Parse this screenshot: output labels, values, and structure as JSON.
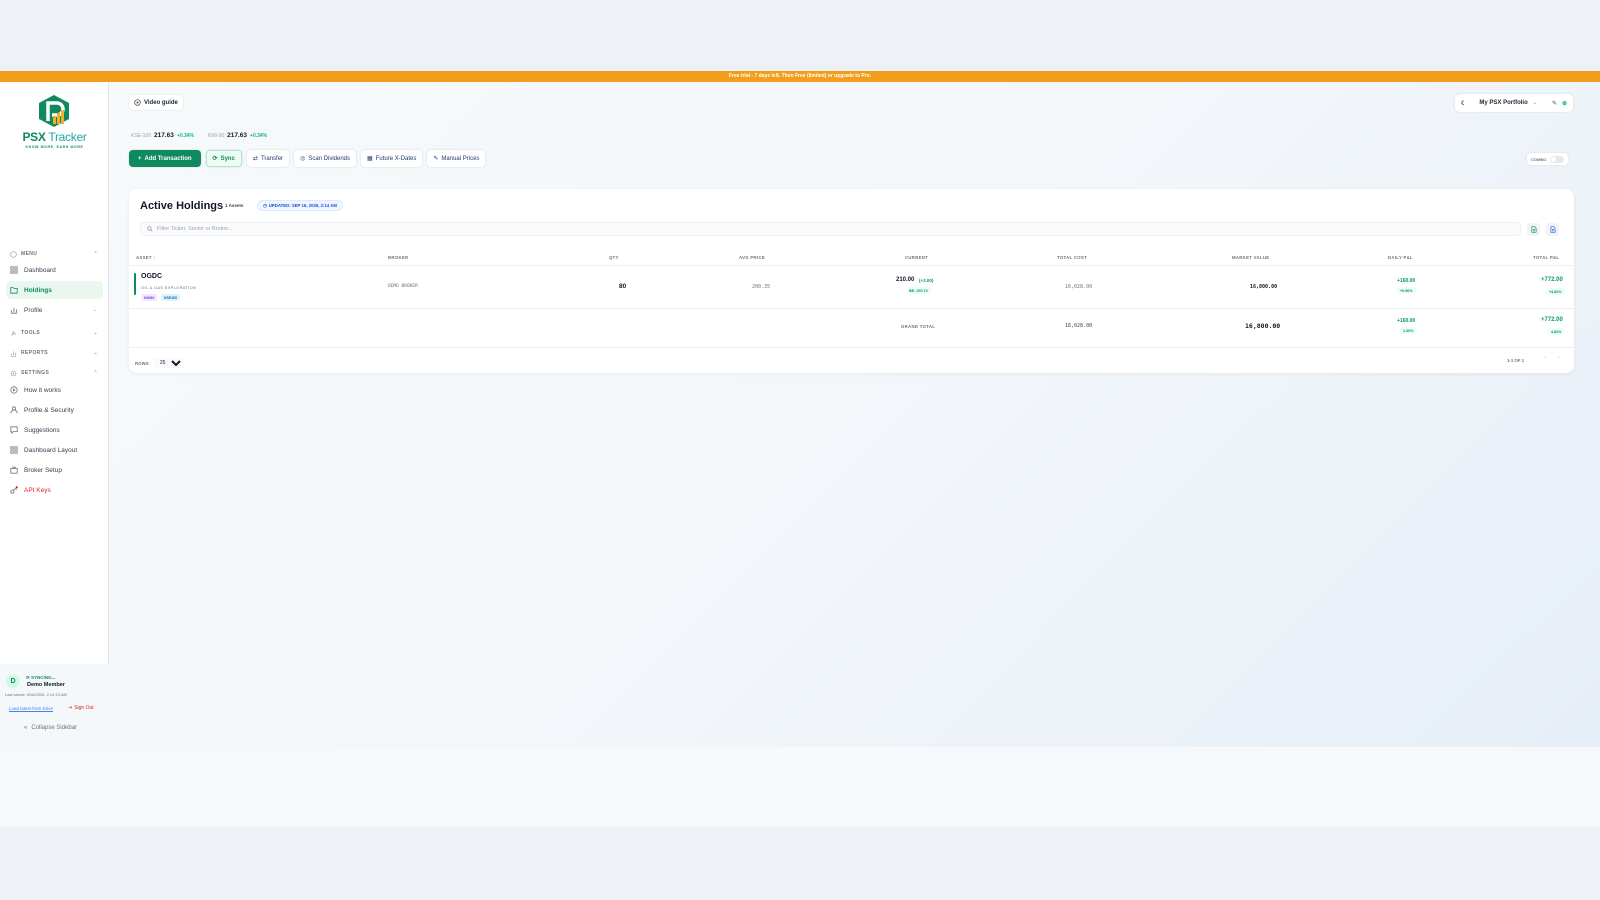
{
  "banner": {
    "text": "Free trial - 7 days left. Then Free (limited) or upgrade to Pro."
  },
  "brand": {
    "name_part1": "PSX",
    "name_part2": " Tracker",
    "tagline": "KNOW MORE. EARN MORE"
  },
  "sidebar": {
    "sections": {
      "menu": "MENU",
      "tools": "TOOLS",
      "reports": "REPORTS",
      "settings": "SETTINGS"
    },
    "menu_items": [
      "Dashboard",
      "Holdings",
      "Profile"
    ],
    "settings_items": [
      "How it works",
      "Profile & Security",
      "Suggestions",
      "Dashboard Layout",
      "Broker Setup",
      "API Keys"
    ],
    "user": {
      "avatar_letter": "D",
      "sync_status": "SYNCING...",
      "name": "Demo Member",
      "last_saved": "Last saved: 9/16/2026, 2:14:13 AM"
    },
    "load_link": "Load latest from Drive",
    "sign_out": "Sign Out",
    "collapse": "Collapse Sidebar"
  },
  "header": {
    "video_guide": "Video guide",
    "portfolio_name": "My PSX Portfolio",
    "indices": [
      {
        "name": "KSE-100",
        "value": "217.63",
        "change": "+0.34%"
      },
      {
        "name": "KMI-30",
        "value": "217.63",
        "change": "+0.34%"
      }
    ]
  },
  "toolbar": {
    "add_transaction": "Add Transaction",
    "sync": "Sync",
    "transfer": "Transfer",
    "scan_dividends": "Scan Dividends",
    "future_xdates": "Future X-Dates",
    "manual_prices": "Manual Prices",
    "combo_label": "COMBO"
  },
  "holdings": {
    "title": "Active Holdings",
    "assets_count": "1 Assets",
    "updated": "UPDATED: SEP 16, 2026, 2:14 AM",
    "search_placeholder": "Filter Ticker, Sector or Broker...",
    "columns": [
      "ASSET",
      "BROKER",
      "QTY",
      "AVG PRICE",
      "CURRENT",
      "TOTAL COST",
      "MARKET VALUE",
      "DAILY P&L",
      "TOTAL P&L"
    ],
    "rows": [
      {
        "ticker": "OGDC",
        "sector": "OIL & GAS EXPLORATION",
        "tags": [
          "KMI30",
          "KSE100"
        ],
        "broker": "DEMO BROKER",
        "qty": "80",
        "avg_price": "200.35",
        "current": "210.00",
        "current_change": "(+2.00)",
        "be": "BE: 200.70",
        "total_cost": "16,028.00",
        "market_value": "16,800.00",
        "daily_pl": "+160.00",
        "daily_pl_pct": "+0.96%",
        "total_pl": "+772.00",
        "total_pl_pct": "+4.82%"
      }
    ],
    "grand_total": {
      "label": "GRAND TOTAL",
      "total_cost": "16,028.00",
      "market_value": "16,800.00",
      "daily_pl": "+160.00",
      "daily_pl_pct": "1.00%",
      "total_pl": "+772.00",
      "total_pl_pct": "4.82%"
    },
    "rows_label": "ROWS:",
    "rows_per_page": "25",
    "page_info": "1-1 OF 1"
  }
}
